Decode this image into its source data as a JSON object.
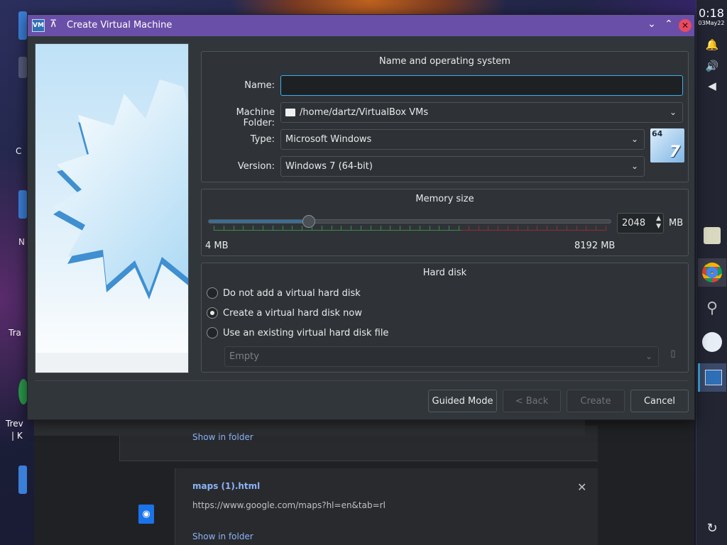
{
  "dialog": {
    "title": "Create Virtual Machine",
    "name_section": {
      "title": "Name and operating system",
      "name_label": "Name:",
      "name_value": "",
      "folder_label": "Machine Folder:",
      "folder_value": "/home/dartz/VirtualBox VMs",
      "type_label": "Type:",
      "type_value": "Microsoft Windows",
      "version_label": "Version:",
      "version_value": "Windows 7 (64-bit)",
      "os_icon_bits": "64",
      "os_icon_version": "7"
    },
    "memory_section": {
      "title": "Memory size",
      "value": "2048",
      "unit": "MB",
      "min_label": "4 MB",
      "max_label": "8192 MB",
      "slider_fraction": 0.25
    },
    "disk_section": {
      "title": "Hard disk",
      "options": [
        {
          "label": "Do not add a virtual hard disk",
          "checked": false
        },
        {
          "label": "Create a virtual hard disk now",
          "checked": true
        },
        {
          "label": "Use an existing virtual hard disk file",
          "checked": false
        }
      ],
      "existing_file_value": "Empty"
    },
    "buttons": {
      "guided": "Guided Mode",
      "back": "< Back",
      "create": "Create",
      "cancel": "Cancel"
    }
  },
  "downloads": {
    "show_in_folder_1": "Show in folder",
    "file_name": "maps (1).html",
    "file_url": "https://www.google.com/maps?hl=en&tab=rl",
    "show_in_folder_2": "Show in folder"
  },
  "desktop": {
    "labels": [
      "C",
      "N",
      "Tra",
      "Trev",
      "| K"
    ]
  },
  "panel": {
    "time": "0:18",
    "date": "03May22"
  },
  "colors": {
    "titlebar": "#6a4fa8",
    "accent": "#3daee9",
    "close": "#e94a5f",
    "link": "#8ab4f8"
  }
}
